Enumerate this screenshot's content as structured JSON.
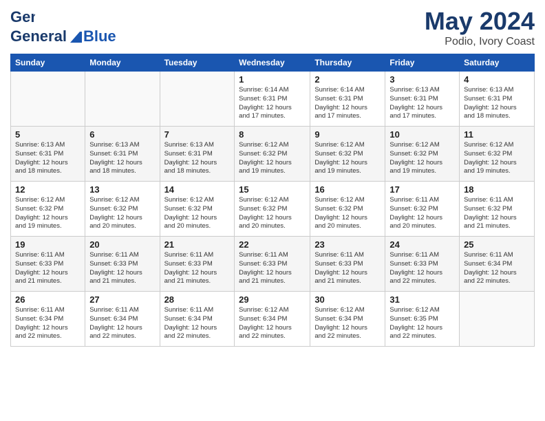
{
  "header": {
    "logo_general": "General",
    "logo_blue": "Blue",
    "month_title": "May 2024",
    "location": "Podio, Ivory Coast"
  },
  "weekdays": [
    "Sunday",
    "Monday",
    "Tuesday",
    "Wednesday",
    "Thursday",
    "Friday",
    "Saturday"
  ],
  "weeks": [
    {
      "days": [
        {
          "num": "",
          "info": ""
        },
        {
          "num": "",
          "info": ""
        },
        {
          "num": "",
          "info": ""
        },
        {
          "num": "1",
          "info": "Sunrise: 6:14 AM\nSunset: 6:31 PM\nDaylight: 12 hours\nand 17 minutes."
        },
        {
          "num": "2",
          "info": "Sunrise: 6:14 AM\nSunset: 6:31 PM\nDaylight: 12 hours\nand 17 minutes."
        },
        {
          "num": "3",
          "info": "Sunrise: 6:13 AM\nSunset: 6:31 PM\nDaylight: 12 hours\nand 17 minutes."
        },
        {
          "num": "4",
          "info": "Sunrise: 6:13 AM\nSunset: 6:31 PM\nDaylight: 12 hours\nand 18 minutes."
        }
      ]
    },
    {
      "days": [
        {
          "num": "5",
          "info": "Sunrise: 6:13 AM\nSunset: 6:31 PM\nDaylight: 12 hours\nand 18 minutes."
        },
        {
          "num": "6",
          "info": "Sunrise: 6:13 AM\nSunset: 6:31 PM\nDaylight: 12 hours\nand 18 minutes."
        },
        {
          "num": "7",
          "info": "Sunrise: 6:13 AM\nSunset: 6:31 PM\nDaylight: 12 hours\nand 18 minutes."
        },
        {
          "num": "8",
          "info": "Sunrise: 6:12 AM\nSunset: 6:32 PM\nDaylight: 12 hours\nand 19 minutes."
        },
        {
          "num": "9",
          "info": "Sunrise: 6:12 AM\nSunset: 6:32 PM\nDaylight: 12 hours\nand 19 minutes."
        },
        {
          "num": "10",
          "info": "Sunrise: 6:12 AM\nSunset: 6:32 PM\nDaylight: 12 hours\nand 19 minutes."
        },
        {
          "num": "11",
          "info": "Sunrise: 6:12 AM\nSunset: 6:32 PM\nDaylight: 12 hours\nand 19 minutes."
        }
      ]
    },
    {
      "days": [
        {
          "num": "12",
          "info": "Sunrise: 6:12 AM\nSunset: 6:32 PM\nDaylight: 12 hours\nand 19 minutes."
        },
        {
          "num": "13",
          "info": "Sunrise: 6:12 AM\nSunset: 6:32 PM\nDaylight: 12 hours\nand 20 minutes."
        },
        {
          "num": "14",
          "info": "Sunrise: 6:12 AM\nSunset: 6:32 PM\nDaylight: 12 hours\nand 20 minutes."
        },
        {
          "num": "15",
          "info": "Sunrise: 6:12 AM\nSunset: 6:32 PM\nDaylight: 12 hours\nand 20 minutes."
        },
        {
          "num": "16",
          "info": "Sunrise: 6:12 AM\nSunset: 6:32 PM\nDaylight: 12 hours\nand 20 minutes."
        },
        {
          "num": "17",
          "info": "Sunrise: 6:11 AM\nSunset: 6:32 PM\nDaylight: 12 hours\nand 20 minutes."
        },
        {
          "num": "18",
          "info": "Sunrise: 6:11 AM\nSunset: 6:32 PM\nDaylight: 12 hours\nand 21 minutes."
        }
      ]
    },
    {
      "days": [
        {
          "num": "19",
          "info": "Sunrise: 6:11 AM\nSunset: 6:33 PM\nDaylight: 12 hours\nand 21 minutes."
        },
        {
          "num": "20",
          "info": "Sunrise: 6:11 AM\nSunset: 6:33 PM\nDaylight: 12 hours\nand 21 minutes."
        },
        {
          "num": "21",
          "info": "Sunrise: 6:11 AM\nSunset: 6:33 PM\nDaylight: 12 hours\nand 21 minutes."
        },
        {
          "num": "22",
          "info": "Sunrise: 6:11 AM\nSunset: 6:33 PM\nDaylight: 12 hours\nand 21 minutes."
        },
        {
          "num": "23",
          "info": "Sunrise: 6:11 AM\nSunset: 6:33 PM\nDaylight: 12 hours\nand 21 minutes."
        },
        {
          "num": "24",
          "info": "Sunrise: 6:11 AM\nSunset: 6:33 PM\nDaylight: 12 hours\nand 22 minutes."
        },
        {
          "num": "25",
          "info": "Sunrise: 6:11 AM\nSunset: 6:34 PM\nDaylight: 12 hours\nand 22 minutes."
        }
      ]
    },
    {
      "days": [
        {
          "num": "26",
          "info": "Sunrise: 6:11 AM\nSunset: 6:34 PM\nDaylight: 12 hours\nand 22 minutes."
        },
        {
          "num": "27",
          "info": "Sunrise: 6:11 AM\nSunset: 6:34 PM\nDaylight: 12 hours\nand 22 minutes."
        },
        {
          "num": "28",
          "info": "Sunrise: 6:11 AM\nSunset: 6:34 PM\nDaylight: 12 hours\nand 22 minutes."
        },
        {
          "num": "29",
          "info": "Sunrise: 6:12 AM\nSunset: 6:34 PM\nDaylight: 12 hours\nand 22 minutes."
        },
        {
          "num": "30",
          "info": "Sunrise: 6:12 AM\nSunset: 6:34 PM\nDaylight: 12 hours\nand 22 minutes."
        },
        {
          "num": "31",
          "info": "Sunrise: 6:12 AM\nSunset: 6:35 PM\nDaylight: 12 hours\nand 22 minutes."
        },
        {
          "num": "",
          "info": ""
        }
      ]
    }
  ]
}
